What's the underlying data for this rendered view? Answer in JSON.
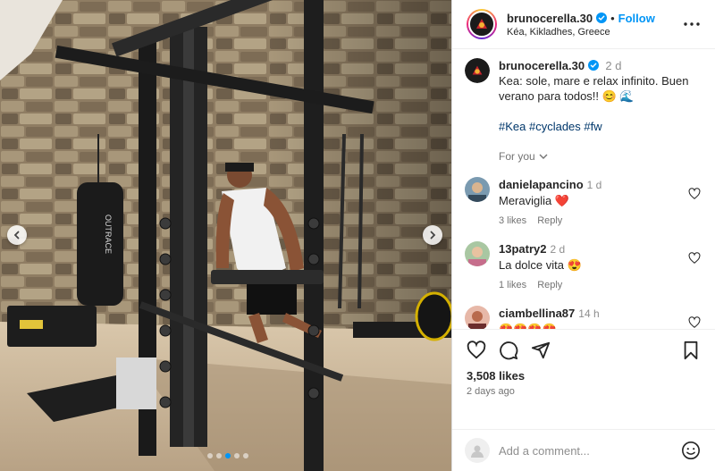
{
  "post": {
    "username": "brunocerella.30",
    "follow_label": "Follow",
    "separator": "•",
    "location": "Kéa, Kikladhes, Greece",
    "caption_time": "2 d",
    "caption_text": "Kea: sole, mare e relax infinito. Buen verano para todos!! 😊 🌊",
    "hashtags": "#Kea #cyclades #fw",
    "for_you": "For you",
    "likes": "3,508 likes",
    "posted_ago": "2 days ago",
    "comment_placeholder": "Add a comment...",
    "brand_text": "OUTRACE"
  },
  "comments": [
    {
      "user": "danielapancino",
      "time": "1 d",
      "text": "Meraviglia ❤️",
      "likes": "3 likes",
      "reply": "Reply"
    },
    {
      "user": "13patry2",
      "time": "2 d",
      "text": "La dolce vita 😍",
      "likes": "1 likes",
      "reply": "Reply"
    },
    {
      "user": "ciambellina87",
      "time": "14 h",
      "text": "😍😍😍😍",
      "likes": "",
      "reply": ""
    }
  ],
  "colors": {
    "accent": "#0095f6",
    "hashtag": "#00376b",
    "heart": "#ff3040"
  },
  "icons": [
    "verified-badge-icon",
    "more-options-icon",
    "chevron-down-icon",
    "heart-icon",
    "comment-icon",
    "share-icon",
    "bookmark-icon",
    "emoji-icon",
    "chevron-left-icon",
    "chevron-right-icon"
  ]
}
